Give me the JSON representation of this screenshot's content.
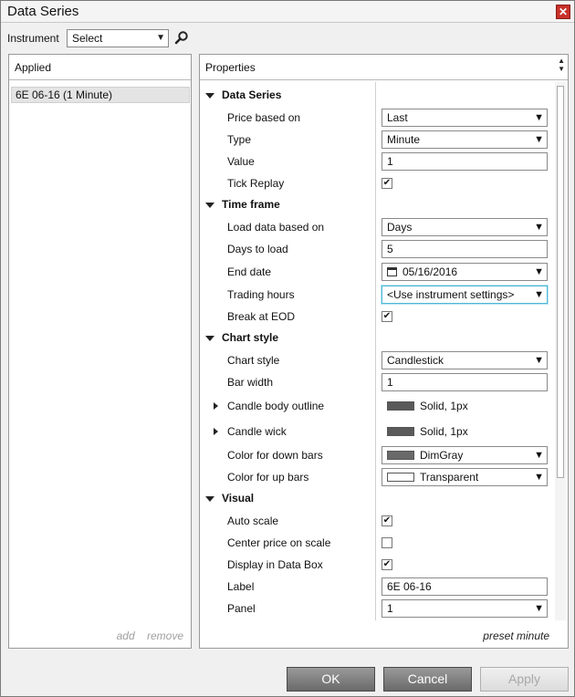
{
  "window": {
    "title": "Data Series",
    "close_glyph": "✕"
  },
  "instrument": {
    "label": "Instrument",
    "value": "Select"
  },
  "applied": {
    "header": "Applied",
    "items": [
      "6E 06-16 (1 Minute)"
    ],
    "add_label": "add",
    "remove_label": "remove"
  },
  "properties": {
    "header": "Properties",
    "preset_label": "preset minute",
    "data_series": {
      "title": "Data Series",
      "price_based_on": {
        "label": "Price based on",
        "value": "Last"
      },
      "type": {
        "label": "Type",
        "value": "Minute"
      },
      "value": {
        "label": "Value",
        "value": "1"
      },
      "tick_replay": {
        "label": "Tick Replay",
        "checked": true
      }
    },
    "time_frame": {
      "title": "Time frame",
      "load_data_based_on": {
        "label": "Load data based on",
        "value": "Days"
      },
      "days_to_load": {
        "label": "Days to load",
        "value": "5"
      },
      "end_date": {
        "label": "End date",
        "value": "05/16/2016"
      },
      "trading_hours": {
        "label": "Trading hours",
        "value": "<Use instrument settings>"
      },
      "break_at_eod": {
        "label": "Break at EOD",
        "checked": true
      }
    },
    "chart_style": {
      "title": "Chart style",
      "chart_style": {
        "label": "Chart style",
        "value": "Candlestick"
      },
      "bar_width": {
        "label": "Bar width",
        "value": "1"
      },
      "candle_body_outline": {
        "label": "Candle body outline",
        "value": "Solid, 1px",
        "color": "#5a5a5a"
      },
      "candle_wick": {
        "label": "Candle wick",
        "value": "Solid, 1px",
        "color": "#5a5a5a"
      },
      "color_down_bars": {
        "label": "Color for down bars",
        "value": "DimGray",
        "color": "#696969"
      },
      "color_up_bars": {
        "label": "Color for up bars",
        "value": "Transparent",
        "color": "#ffffff"
      }
    },
    "visual": {
      "title": "Visual",
      "auto_scale": {
        "label": "Auto scale",
        "checked": true
      },
      "center_price": {
        "label": "Center price on scale",
        "checked": false
      },
      "display_data_box": {
        "label": "Display in Data Box",
        "checked": true
      },
      "label": {
        "label": "Label",
        "value": "6E 06-16"
      },
      "panel": {
        "label": "Panel",
        "value": "1"
      }
    }
  },
  "buttons": {
    "ok": "OK",
    "cancel": "Cancel",
    "apply": "Apply"
  },
  "icons": {
    "chevron": "chevron-down-icon",
    "check": "✔"
  }
}
